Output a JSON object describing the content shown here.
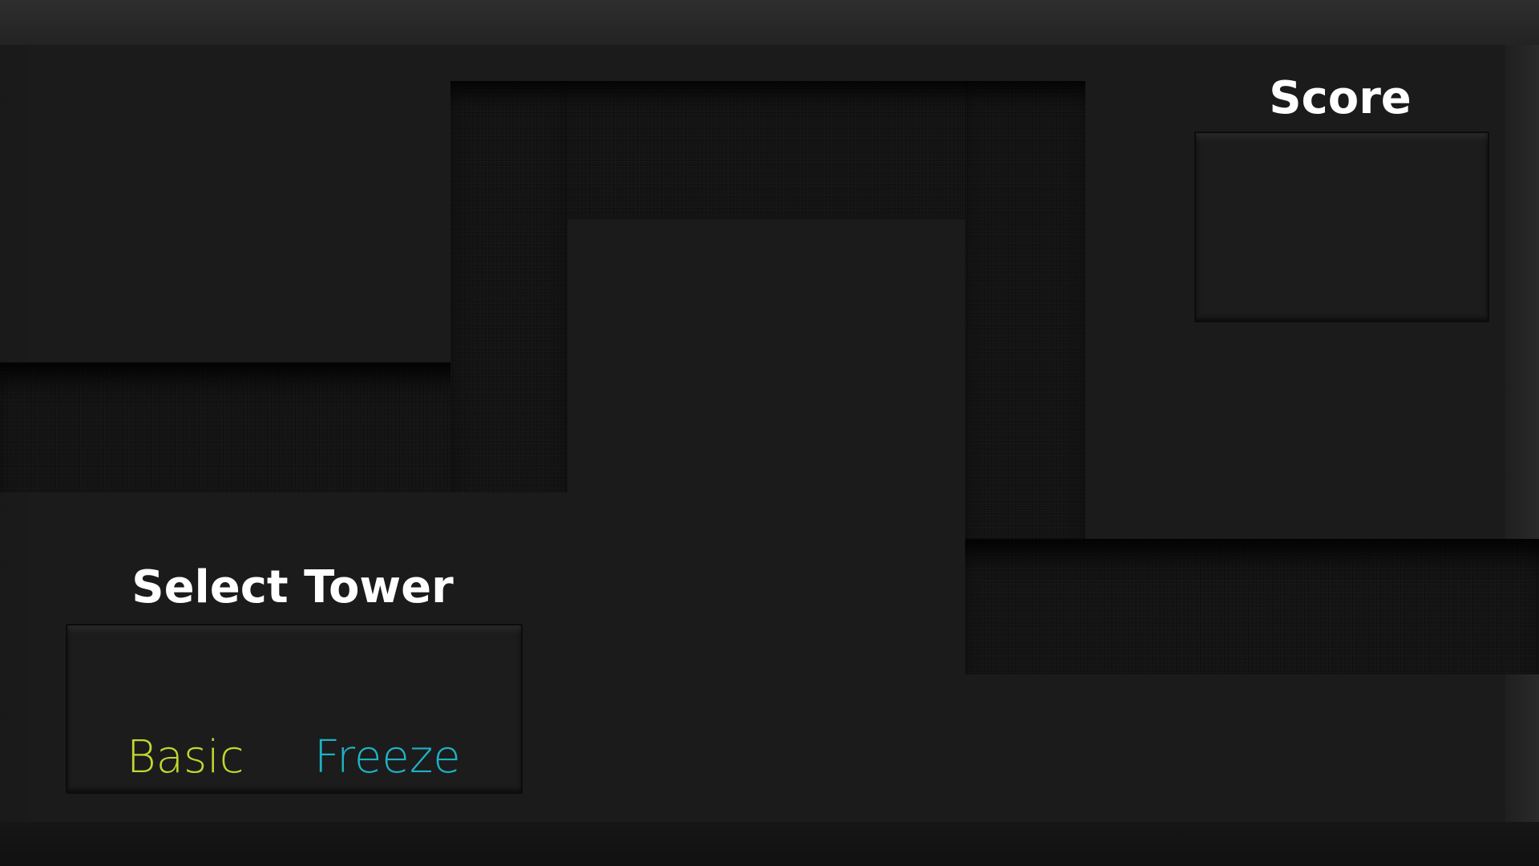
{
  "score_panel": {
    "title": "Score",
    "value": ""
  },
  "tower_panel": {
    "title": "Select Tower",
    "options": [
      {
        "label": "Basic",
        "color": "#c2d82e"
      },
      {
        "label": "Freeze",
        "color": "#1fb1c4"
      }
    ]
  },
  "colors": {
    "background": "#1b1b1b",
    "path": "#121212",
    "title_text": "#ffffff"
  }
}
